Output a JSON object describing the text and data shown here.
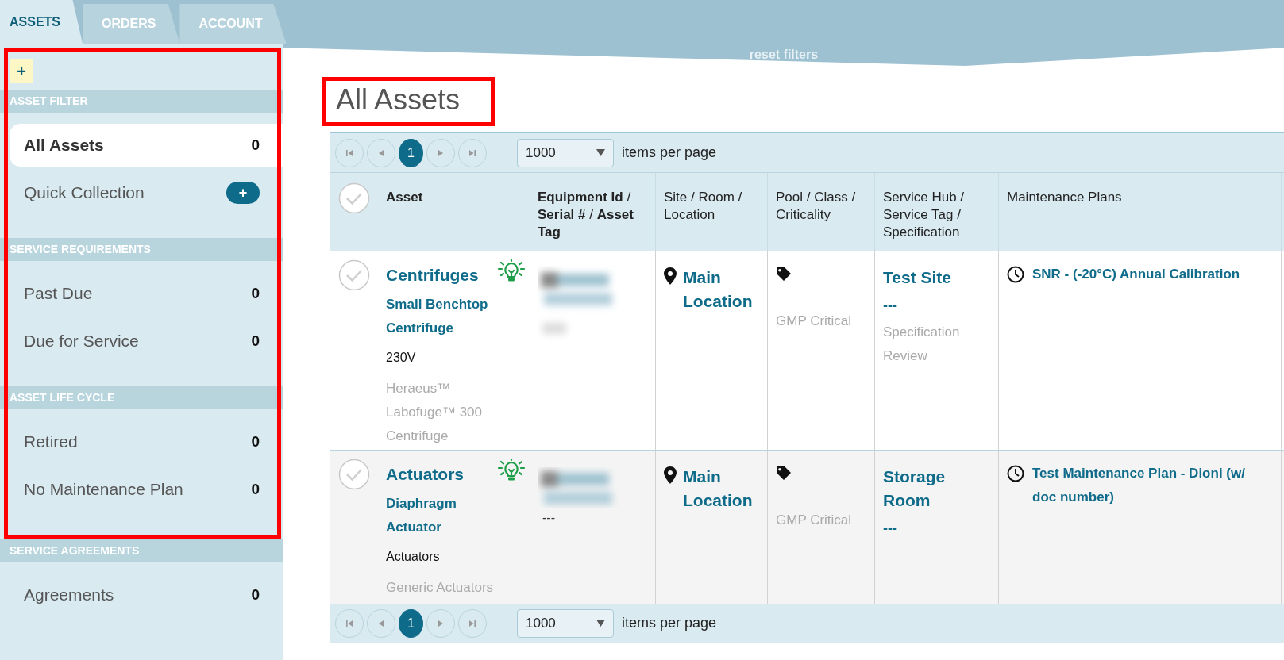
{
  "tabs": [
    {
      "label": "ASSETS",
      "selected": true
    },
    {
      "label": "ORDERS",
      "selected": false
    },
    {
      "label": "ACCOUNT",
      "selected": false
    }
  ],
  "reset_filters": "reset filters",
  "sidebar": {
    "add_button": "+",
    "framed_group": {
      "highlighted": true,
      "sections": [
        {
          "title": "ASSET FILTER",
          "items": [
            {
              "kind": "count",
              "label": "All Assets",
              "count": "0",
              "selected": true
            },
            {
              "kind": "add",
              "label": "Quick Collection",
              "action": "+",
              "selected": false
            }
          ]
        },
        {
          "title": "SERVICE REQUIREMENTS",
          "items": [
            {
              "kind": "count",
              "label": "Past Due",
              "count": "0",
              "selected": false
            },
            {
              "kind": "count",
              "label": "Due for Service",
              "count": "0",
              "selected": false
            }
          ]
        },
        {
          "title": "ASSET LIFE CYCLE",
          "items": [
            {
              "kind": "count",
              "label": "Retired",
              "count": "0",
              "selected": false
            },
            {
              "kind": "count",
              "label": "No Maintenance Plan",
              "count": "0",
              "selected": false
            }
          ]
        }
      ]
    },
    "sections": [
      {
        "title": "SERVICE AGREEMENTS",
        "items": [
          {
            "kind": "count",
            "label": "Agreements",
            "count": "0",
            "selected": false
          }
        ]
      }
    ]
  },
  "page_title": {
    "text": "All Assets",
    "highlighted": true
  },
  "pagers": [
    {
      "pages": [
        {
          "label": "1",
          "selected": true
        }
      ],
      "page_size": "1000",
      "page_size_label": "items per page"
    },
    {
      "pages": [
        {
          "label": "1",
          "selected": true
        }
      ],
      "page_size": "1000",
      "page_size_label": "items per page"
    }
  ],
  "table": {
    "select_all": {
      "checked": false
    },
    "columns": [
      {
        "label": "Asset",
        "bold": true
      },
      {
        "label": "**Equipment Id** / **Serial #** / **Asset Tag**",
        "bold": false
      },
      {
        "label": "Site / Room / Location",
        "bold": false
      },
      {
        "label": "Pool / Class / Criticality",
        "bold": false
      },
      {
        "label": "Service Hub / Service Tag / Specification",
        "bold": false
      },
      {
        "label": "Maintenance Plans",
        "bold": false
      }
    ],
    "rows": [
      {
        "checked": false,
        "category": "Centrifuges",
        "model": "Small Benchtop Centrifuge",
        "type": "230V",
        "description": "Heraeus™ Labofuge™ 300 Centrifuge",
        "equipment": {
          "redacted": true
        },
        "location": "Main Location",
        "criticality": "GMP Critical",
        "service_hub": "Test Site",
        "service_tag": "---",
        "specification": "Specification Review",
        "maintenance_plan": "SNR - (-20°C) Annual Calibration"
      },
      {
        "checked": false,
        "category": "Actuators",
        "model": "Diaphragm Actuator",
        "type": "Actuators",
        "description": "Generic Actuators",
        "equipment": {
          "redacted": true,
          "serial": "---"
        },
        "location": "Main Location",
        "criticality": "GMP Critical",
        "service_hub": "Storage Room",
        "service_tag": "---",
        "maintenance_plan": "Test Maintenance Plan - Dioni (w/ doc number)"
      }
    ]
  }
}
